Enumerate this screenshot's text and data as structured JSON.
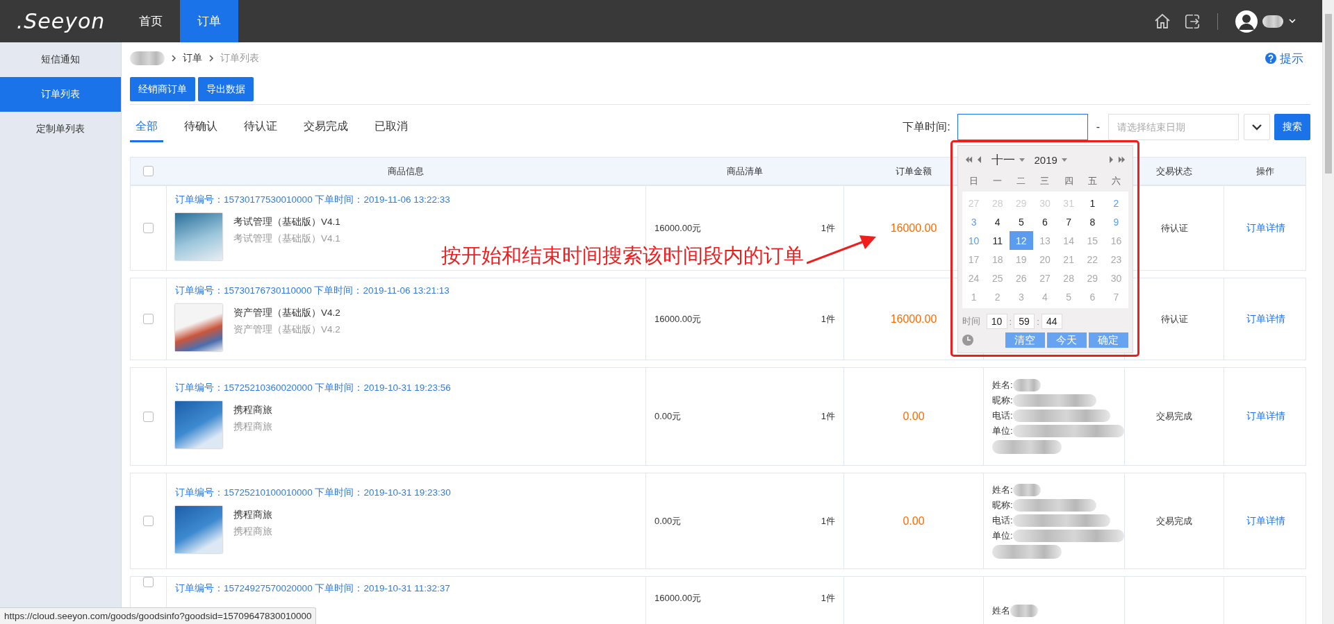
{
  "topbar": {
    "logo": ".Seeyon",
    "nav": [
      {
        "label": "首页",
        "selected": false
      },
      {
        "label": "订单",
        "selected": true
      }
    ]
  },
  "sidebar": {
    "items": [
      {
        "label": "短信通知",
        "selected": false
      },
      {
        "label": "订单列表",
        "selected": true
      },
      {
        "label": "定制单列表",
        "selected": false
      }
    ]
  },
  "breadcrumb": [
    "订单",
    "订单列表"
  ],
  "help_link": "提示",
  "action_buttons": [
    "经销商订单",
    "导出数据"
  ],
  "status_tabs": [
    {
      "label": "全部",
      "selected": true
    },
    {
      "label": "待确认",
      "selected": false
    },
    {
      "label": "待认证",
      "selected": false
    },
    {
      "label": "交易完成",
      "selected": false
    },
    {
      "label": "已取消",
      "selected": false
    }
  ],
  "search": {
    "label": "下单时间:",
    "start_field": {
      "focused": true
    },
    "separator": "-",
    "end_field": {
      "placeholder": "请选择结束日期"
    },
    "button": "搜索"
  },
  "table": {
    "header_checked": false,
    "columns": [
      "商品信息",
      "商品清单",
      "订单金额",
      "交易状态",
      "操作"
    ],
    "rows": [
      {
        "checked": false,
        "order_line": "订单编号：15730177530010000 下单时间：2019-11-06 13:22:33",
        "product": {
          "name": "考试管理（基础版）V4.1",
          "subname": "考试管理（基础版）V4.1",
          "kind": "exam"
        },
        "price": "16000.00元",
        "qty": "1件",
        "amount": "16000.00",
        "status": "待认证",
        "action": "订单详情"
      },
      {
        "checked": false,
        "order_line": "订单编号：15730176730110000 下单时间：2019-11-06 13:21:13",
        "product": {
          "name": "资产管理（基础版）V4.2",
          "subname": "资产管理（基础版）V4.2",
          "kind": "asset"
        },
        "price": "16000.00元",
        "qty": "1件",
        "amount": "16000.00",
        "status": "待认证",
        "action": "订单详情"
      },
      {
        "checked": false,
        "order_line": "订单编号：15725210360020000 下单时间：2019-10-31 19:23:56",
        "product": {
          "name": "携程商旅",
          "subname": "携程商旅",
          "kind": "sky"
        },
        "price": "0.00元",
        "qty": "1件",
        "amount": "0.00",
        "buyer": [
          "姓名:",
          "昵称:",
          "电话:",
          "单位:"
        ],
        "status": "交易完成",
        "action": "订单详情"
      },
      {
        "checked": false,
        "order_line": "订单编号：15725210100010000 下单时间：2019-10-31 19:23:30",
        "product": {
          "name": "携程商旅",
          "subname": "携程商旅",
          "kind": "sky"
        },
        "price": "0.00元",
        "qty": "1件",
        "amount": "0.00",
        "buyer": [
          "姓名:",
          "昵称:",
          "电话:",
          "单位:"
        ],
        "status": "交易完成",
        "action": "订单详情"
      },
      {
        "checked": false,
        "order_line": "订单编号：15724927570020000 下单时间：2019-10-31 11:32:37",
        "price": "16000.00元",
        "qty": "1件",
        "buyer": [
          "姓名"
        ]
      }
    ]
  },
  "calendar": {
    "month": "十一",
    "year": "2019",
    "weekdays": [
      "日",
      "一",
      "二",
      "三",
      "四",
      "五",
      "六"
    ],
    "weeks": [
      [
        {
          "d": "27",
          "kind": "other",
          "selected": false
        },
        {
          "d": "28",
          "kind": "other",
          "selected": false
        },
        {
          "d": "29",
          "kind": "other",
          "selected": false
        },
        {
          "d": "30",
          "kind": "other",
          "selected": false
        },
        {
          "d": "31",
          "kind": "other",
          "selected": false
        },
        {
          "d": "1",
          "kind": "weekday",
          "selected": false
        },
        {
          "d": "2",
          "kind": "weekend",
          "selected": false
        }
      ],
      [
        {
          "d": "3",
          "kind": "weekend",
          "selected": false
        },
        {
          "d": "4",
          "kind": "weekday",
          "selected": false
        },
        {
          "d": "5",
          "kind": "weekday",
          "selected": false
        },
        {
          "d": "6",
          "kind": "weekday",
          "selected": false
        },
        {
          "d": "7",
          "kind": "weekday",
          "selected": false
        },
        {
          "d": "8",
          "kind": "weekday",
          "selected": false
        },
        {
          "d": "9",
          "kind": "weekend",
          "selected": false
        }
      ],
      [
        {
          "d": "10",
          "kind": "weekend",
          "selected": false
        },
        {
          "d": "11",
          "kind": "weekday",
          "selected": false
        },
        {
          "d": "12",
          "kind": "weekday",
          "selected": true
        },
        {
          "d": "13",
          "kind": "disabled",
          "selected": false
        },
        {
          "d": "14",
          "kind": "disabled",
          "selected": false
        },
        {
          "d": "15",
          "kind": "disabled",
          "selected": false
        },
        {
          "d": "16",
          "kind": "disabled",
          "selected": false
        }
      ],
      [
        {
          "d": "17",
          "kind": "disabled",
          "selected": false
        },
        {
          "d": "18",
          "kind": "disabled",
          "selected": false
        },
        {
          "d": "19",
          "kind": "disabled",
          "selected": false
        },
        {
          "d": "20",
          "kind": "disabled",
          "selected": false
        },
        {
          "d": "21",
          "kind": "disabled",
          "selected": false
        },
        {
          "d": "22",
          "kind": "disabled",
          "selected": false
        },
        {
          "d": "23",
          "kind": "disabled",
          "selected": false
        }
      ],
      [
        {
          "d": "24",
          "kind": "disabled",
          "selected": false
        },
        {
          "d": "25",
          "kind": "disabled",
          "selected": false
        },
        {
          "d": "26",
          "kind": "disabled",
          "selected": false
        },
        {
          "d": "27",
          "kind": "disabled",
          "selected": false
        },
        {
          "d": "28",
          "kind": "disabled",
          "selected": false
        },
        {
          "d": "29",
          "kind": "disabled",
          "selected": false
        },
        {
          "d": "30",
          "kind": "disabled",
          "selected": false
        }
      ],
      [
        {
          "d": "1",
          "kind": "disabled",
          "selected": false
        },
        {
          "d": "2",
          "kind": "disabled",
          "selected": false
        },
        {
          "d": "3",
          "kind": "disabled",
          "selected": false
        },
        {
          "d": "4",
          "kind": "disabled",
          "selected": false
        },
        {
          "d": "5",
          "kind": "disabled",
          "selected": false
        },
        {
          "d": "6",
          "kind": "disabled",
          "selected": false
        },
        {
          "d": "7",
          "kind": "disabled",
          "selected": false
        }
      ]
    ],
    "time_label": "时间",
    "time": [
      "10",
      "59",
      "44"
    ],
    "time_separator": ":",
    "buttons": [
      "清空",
      "今天",
      "确定"
    ]
  },
  "annotation": {
    "text": "按开始和结束时间搜索该时间段内的订单"
  },
  "status_url": "https://cloud.seeyon.com/goods/goodsinfo?goodsid=15709647830010000"
}
